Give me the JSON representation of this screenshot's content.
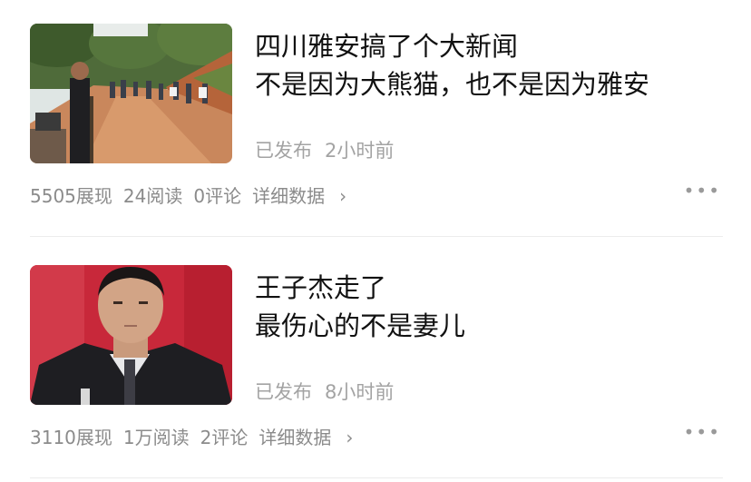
{
  "articles": [
    {
      "title_line1": "四川雅安搞了个大新闻",
      "title_line2": "不是因为大熊猫，也不是因为雅安",
      "status": "已发布",
      "time": "2小时前",
      "views": "5505展现",
      "reads": "24阅读",
      "comments": "0评论",
      "detail": "详细数据",
      "thumbnail_icon": "road-crowd-photo"
    },
    {
      "title_line1": "王子杰走了",
      "title_line2": "最伤心的不是妻儿",
      "status": "已发布",
      "time": "8小时前",
      "views": "3110展现",
      "reads": "1万阅读",
      "comments": "2评论",
      "detail": "详细数据",
      "thumbnail_icon": "portrait-photo"
    }
  ],
  "icons": {
    "chevron": "chevron-right-icon",
    "more": "more-dots-icon"
  },
  "colors": {
    "title": "#111111",
    "meta": "#a3a3a3",
    "stats": "#8b8b8b",
    "divider": "#ececec"
  }
}
